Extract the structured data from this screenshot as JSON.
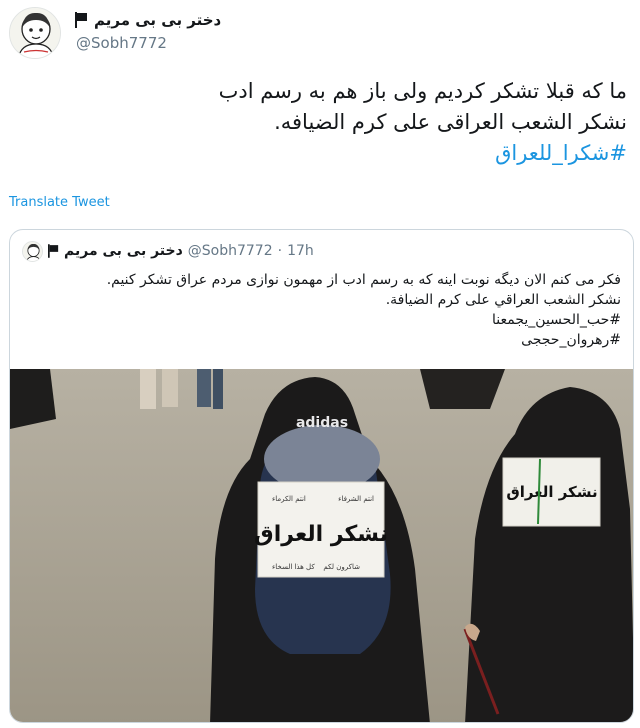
{
  "tweet": {
    "display_name": "دختر بی بی مریم",
    "handle": "@Sobh7772",
    "text_lines": [
      "ما که قبلا تشکر کردیم ولی باز هم به رسم ادب",
      "نشکر الشعب العراقی علی کرم الضیافه."
    ],
    "hashtag": "#شکرا_للعراق",
    "translate_label": "Translate Tweet"
  },
  "quoted_tweet": {
    "display_name": "دختر بی بی مریم",
    "handle": "@Sobh7772",
    "separator": "·",
    "time": "17h",
    "text_lines": [
      "فکر می کنم الان دیگه نوبت اینه که به رسم ادب از مهمون نوازی مردم عراق تشکر کنیم.",
      "نشکر الشعب العراقي على كرم الضيافة."
    ],
    "hashtags": [
      "#حب_الحسین_یجمعنا",
      "#رهروان_حججی"
    ],
    "photo": {
      "sign_main": "نشكر العراق",
      "sign_top_right": "انتم الشرفاء",
      "sign_top_left": "انتم الكرماء",
      "sign_bottom_right": "شاكرون لكم",
      "sign_bottom_left": "كل هذا السخاء",
      "bag_brand": "adidas",
      "right_sign_main": "نشكر العراق"
    }
  },
  "colors": {
    "link": "#1b95e0",
    "secondary_text": "#657786",
    "border": "#ccd6dd"
  },
  "icons": [
    "flag-icon",
    "avatar-drawing"
  ]
}
